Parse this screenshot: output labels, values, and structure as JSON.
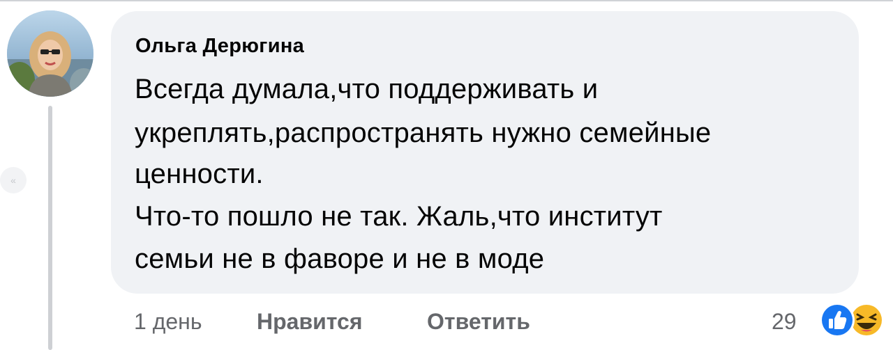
{
  "comment": {
    "author": "Ольга Дерюгина",
    "lines": [
      "Всегда думала,что поддерживать и",
      "укреплять,распространять нужно семейные",
      "ценности.",
      "Что-то пошло не так. Жаль,что институт",
      "семьи не в фаворе и не в моде"
    ]
  },
  "actions": {
    "time": "1 день",
    "like_label": "Нравится",
    "reply_label": "Ответить"
  },
  "reactions": {
    "count": "29",
    "icons": [
      "like-icon",
      "haha-icon"
    ],
    "like_color": "#1877f2",
    "haha_color": "#f7b928"
  },
  "side_nav": {
    "icon": "double-chevron-left-icon",
    "glyph": "«"
  }
}
